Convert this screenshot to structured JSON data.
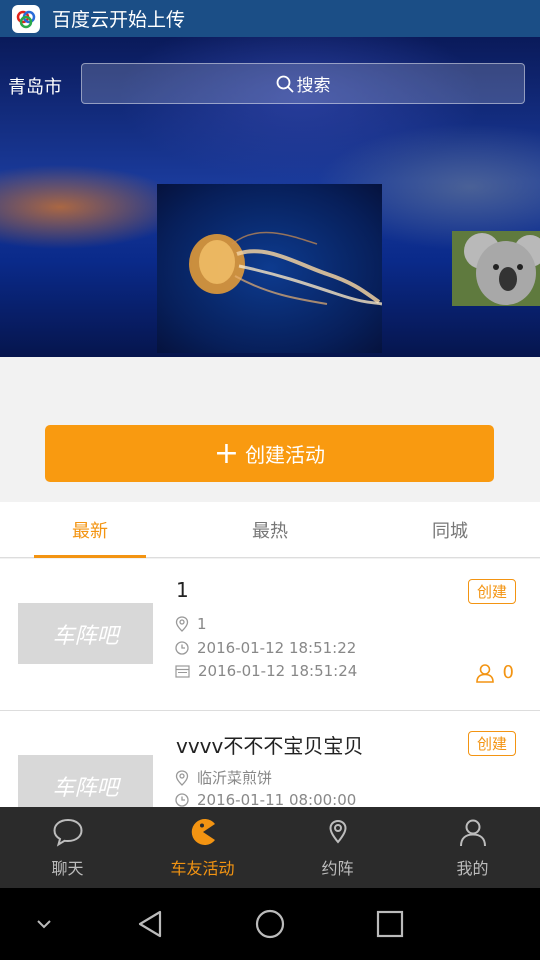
{
  "titlebar": {
    "title": "百度云开始上传",
    "icon": "baidu-cloud-icon"
  },
  "banner": {
    "city": "青岛市",
    "search_label": "搜索",
    "search_icon": "search-icon"
  },
  "create_button": {
    "label": "创建活动",
    "icon": "plus-icon"
  },
  "tabs": [
    {
      "label": "最新",
      "active": true
    },
    {
      "label": "最热",
      "active": false
    },
    {
      "label": "同城",
      "active": false
    }
  ],
  "activities": [
    {
      "title": "1",
      "tag": "创建",
      "location": "1",
      "start_time": "2016-01-12 18:51:22",
      "end_time": "2016-01-12 18:51:24",
      "participants": "0",
      "thumb_text": "车阵吧"
    },
    {
      "title": "vvvv不不不宝贝宝贝",
      "tag": "创建",
      "location": "临沂菜煎饼",
      "start_time": "2016-01-11 08:00:00",
      "thumb_text": "车阵吧"
    }
  ],
  "bottom_nav": [
    {
      "label": "聊天",
      "icon": "chat-bubble-icon",
      "active": false
    },
    {
      "label": "车友活动",
      "icon": "pacman-icon",
      "active": true
    },
    {
      "label": "约阵",
      "icon": "location-pin-icon",
      "active": false
    },
    {
      "label": "我的",
      "icon": "person-icon",
      "active": false
    }
  ],
  "colors": {
    "accent": "#f39412",
    "titlebar": "#1b4e86",
    "nav_bg": "#2b2b2b"
  }
}
